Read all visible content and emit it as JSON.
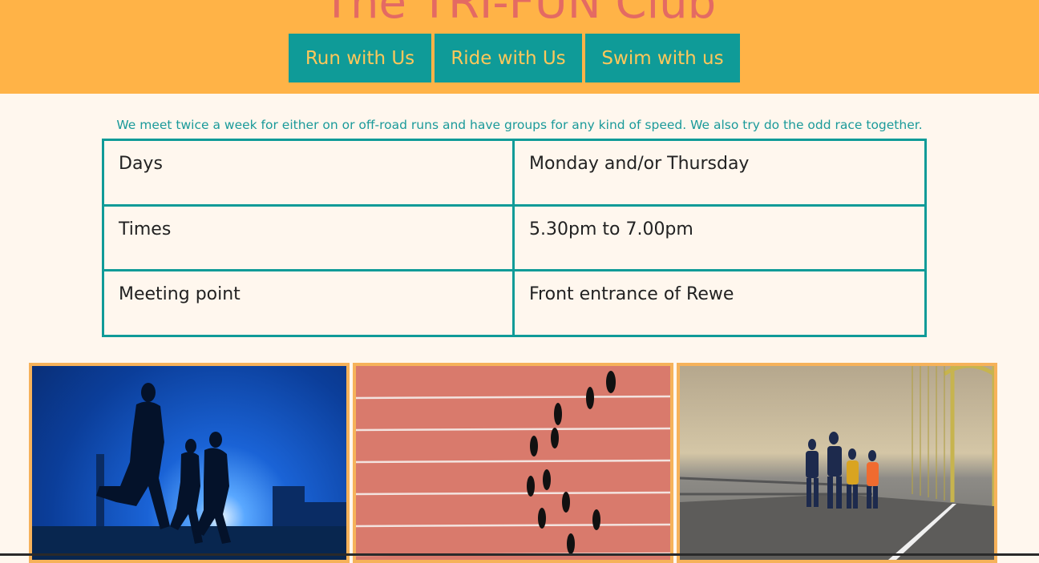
{
  "header": {
    "title": "The TRI-FUN Club",
    "nav": [
      {
        "label": "Run with Us"
      },
      {
        "label": "Ride with Us"
      },
      {
        "label": "Swim with us"
      }
    ]
  },
  "intro": "We meet twice a week for either on or off-road runs and have groups for any kind of speed. We also try do the odd race together.",
  "schedule": [
    {
      "label": "Days",
      "value": "Monday and/or Thursday"
    },
    {
      "label": "Times",
      "value": "5.30pm to 7.00pm"
    },
    {
      "label": "Meeting point",
      "value": "Front entrance of Rewe"
    }
  ],
  "gallery": [
    {
      "alt": "runners-silhouette-photo"
    },
    {
      "alt": "runners-on-track-aerial-photo"
    },
    {
      "alt": "marathon-runners-on-bridge-photo"
    }
  ],
  "colors": {
    "header_bg": "#ffb347",
    "title": "#e46a63",
    "nav_bg": "#0f9b98",
    "nav_text": "#ffc75a",
    "page_bg": "#fff7ee",
    "table_border": "#0f9b98"
  }
}
